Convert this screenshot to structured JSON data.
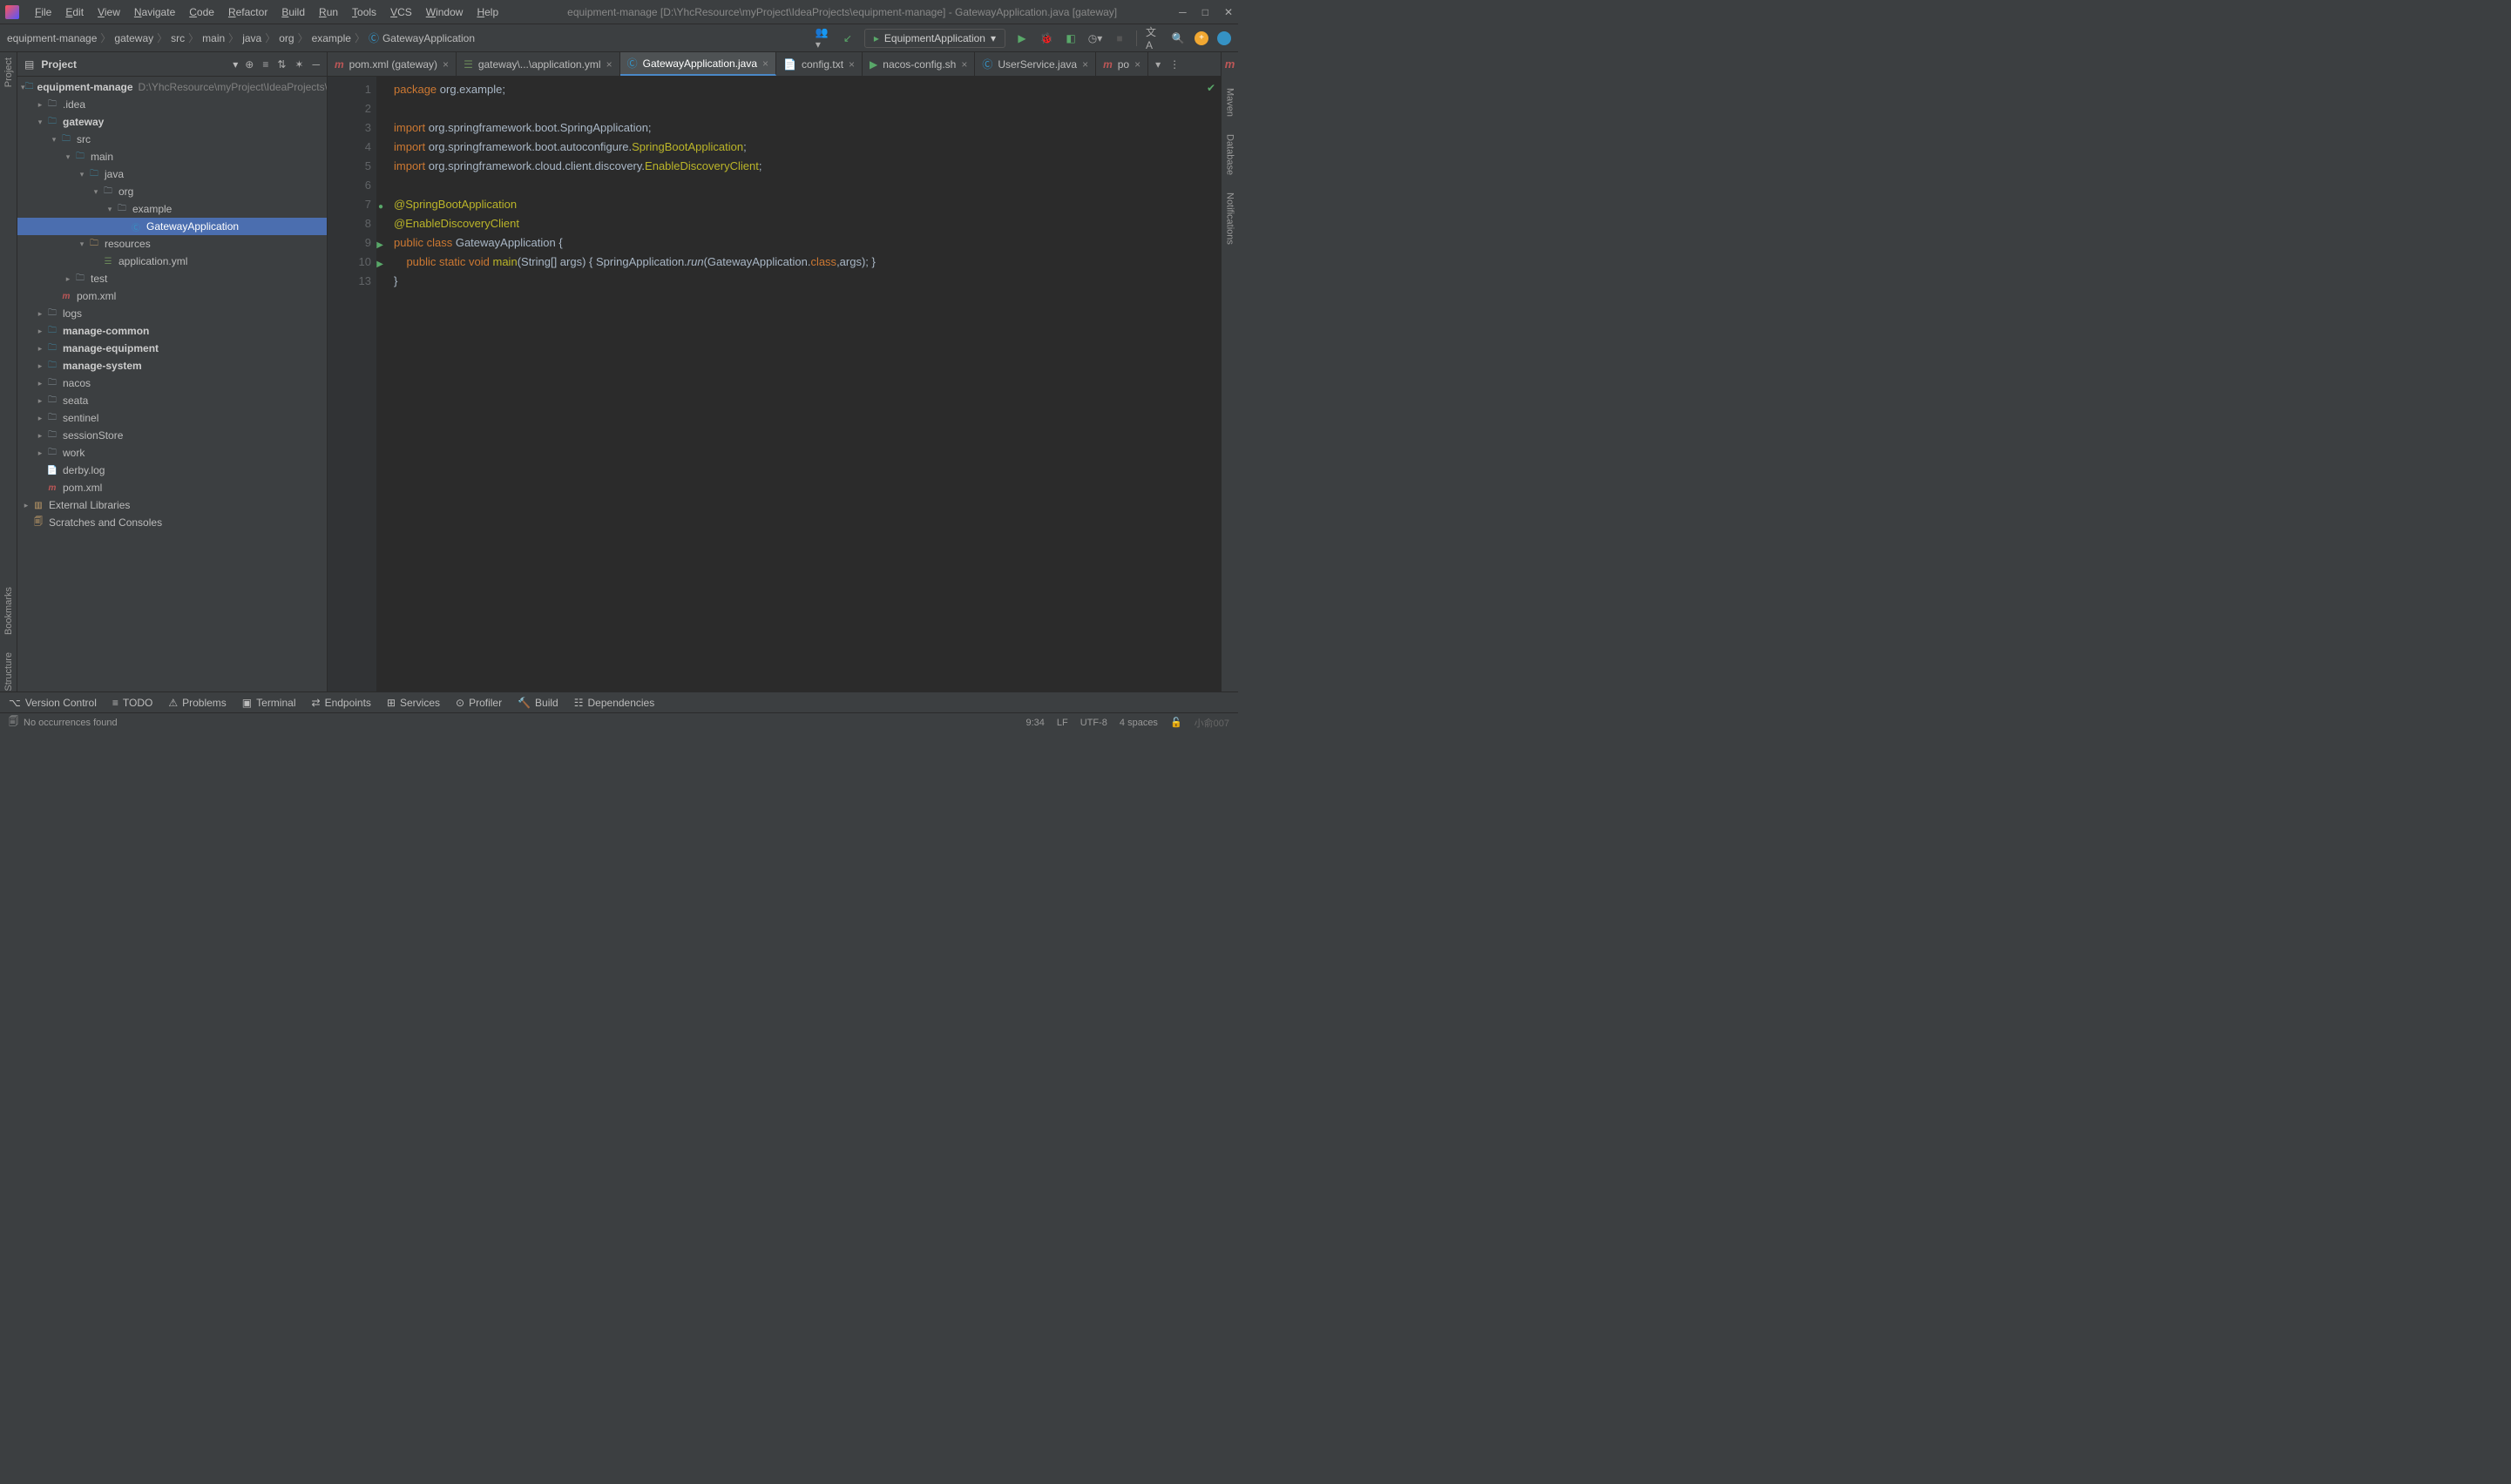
{
  "window": {
    "title": "equipment-manage [D:\\YhcResource\\myProject\\IdeaProjects\\equipment-manage] - GatewayApplication.java [gateway]"
  },
  "menu": [
    "File",
    "Edit",
    "View",
    "Navigate",
    "Code",
    "Refactor",
    "Build",
    "Run",
    "Tools",
    "VCS",
    "Window",
    "Help"
  ],
  "breadcrumb": [
    "equipment-manage",
    "gateway",
    "src",
    "main",
    "java",
    "org",
    "example",
    "GatewayApplication"
  ],
  "runConfig": "EquipmentApplication",
  "projectPanel": {
    "title": "Project"
  },
  "tree": {
    "root": "equipment-manage",
    "rootPath": "D:\\YhcResource\\myProject\\IdeaProjects\\equipment-manage",
    "items": [
      {
        "indent": 1,
        "arrow": ">",
        "icon": "folder",
        "label": ".idea"
      },
      {
        "indent": 1,
        "arrow": "v",
        "icon": "folder-src",
        "label": "gateway",
        "bold": true
      },
      {
        "indent": 2,
        "arrow": "v",
        "icon": "folder-src",
        "label": "src"
      },
      {
        "indent": 3,
        "arrow": "v",
        "icon": "folder-src",
        "label": "main"
      },
      {
        "indent": 4,
        "arrow": "v",
        "icon": "folder-src",
        "label": "java"
      },
      {
        "indent": 5,
        "arrow": "v",
        "icon": "folder",
        "label": "org"
      },
      {
        "indent": 6,
        "arrow": "v",
        "icon": "folder",
        "label": "example"
      },
      {
        "indent": 7,
        "arrow": "",
        "icon": "class",
        "label": "GatewayApplication",
        "selected": true
      },
      {
        "indent": 4,
        "arrow": "v",
        "icon": "folder-res",
        "label": "resources"
      },
      {
        "indent": 5,
        "arrow": "",
        "icon": "yml",
        "label": "application.yml"
      },
      {
        "indent": 3,
        "arrow": ">",
        "icon": "folder",
        "label": "test"
      },
      {
        "indent": 2,
        "arrow": "",
        "icon": "maven",
        "label": "pom.xml"
      },
      {
        "indent": 1,
        "arrow": ">",
        "icon": "folder",
        "label": "logs"
      },
      {
        "indent": 1,
        "arrow": ">",
        "icon": "folder-src",
        "label": "manage-common",
        "bold": true
      },
      {
        "indent": 1,
        "arrow": ">",
        "icon": "folder-src",
        "label": "manage-equipment",
        "bold": true
      },
      {
        "indent": 1,
        "arrow": ">",
        "icon": "folder-src",
        "label": "manage-system",
        "bold": true
      },
      {
        "indent": 1,
        "arrow": ">",
        "icon": "folder",
        "label": "nacos"
      },
      {
        "indent": 1,
        "arrow": ">",
        "icon": "folder",
        "label": "seata"
      },
      {
        "indent": 1,
        "arrow": ">",
        "icon": "folder",
        "label": "sentinel"
      },
      {
        "indent": 1,
        "arrow": ">",
        "icon": "folder",
        "label": "sessionStore"
      },
      {
        "indent": 1,
        "arrow": ">",
        "icon": "folder",
        "label": "work"
      },
      {
        "indent": 1,
        "arrow": "",
        "icon": "file",
        "label": "derby.log"
      },
      {
        "indent": 1,
        "arrow": "",
        "icon": "maven",
        "label": "pom.xml"
      }
    ],
    "external": "External Libraries",
    "scratches": "Scratches and Consoles"
  },
  "tabs": [
    {
      "icon": "maven",
      "label": "pom.xml (gateway)"
    },
    {
      "icon": "yml",
      "label": "gateway\\...\\application.yml"
    },
    {
      "icon": "class",
      "label": "GatewayApplication.java",
      "active": true
    },
    {
      "icon": "file",
      "label": "config.txt"
    },
    {
      "icon": "sh",
      "label": "nacos-config.sh"
    },
    {
      "icon": "class",
      "label": "UserService.java"
    },
    {
      "icon": "maven",
      "label": "po"
    }
  ],
  "code": {
    "lines": [
      {
        "n": 1,
        "html": "<span class='kw'>package</span> <span class='pkg'>org.example</span>;"
      },
      {
        "n": 2,
        "html": ""
      },
      {
        "n": 3,
        "html": "<span class='kw'>import</span> org.springframework.boot.SpringApplication;"
      },
      {
        "n": 4,
        "html": "<span class='kw'>import</span> org.springframework.boot.autoconfigure.<span class='ann'>SpringBootApplication</span>;"
      },
      {
        "n": 5,
        "html": "<span class='kw'>import</span> org.springframework.cloud.client.discovery.<span class='ann'>EnableDiscoveryClient</span>;"
      },
      {
        "n": 6,
        "html": ""
      },
      {
        "n": 7,
        "html": "<span class='ann'>@SpringBootApplication</span>",
        "mark": "●"
      },
      {
        "n": 8,
        "html": "<span class='ann'>@EnableDiscoveryClient</span>"
      },
      {
        "n": 9,
        "html": "<span class='kw'>public</span> <span class='kw'>class</span> <span class='cls'>GatewayApplication</span> {",
        "mark": "▶"
      },
      {
        "n": 10,
        "html": "    <span class='kw'>public</span> <span class='kw'>static</span> <span class='kw'>void</span> <span class='ann'>main</span>(String[] args) { SpringApplication.<span class='fn-it'>run</span>(GatewayApplication.<span class='kw'>class</span>,args); }",
        "mark": "▶"
      },
      {
        "n": 13,
        "html": "}"
      }
    ]
  },
  "bottomTools": [
    "Version Control",
    "TODO",
    "Problems",
    "Terminal",
    "Endpoints",
    "Services",
    "Profiler",
    "Build",
    "Dependencies"
  ],
  "status": {
    "left": "No occurrences found",
    "pos": "9:34",
    "sep": "LF",
    "enc": "UTF-8",
    "indent": "4 spaces"
  },
  "leftRail": [
    "Project",
    "Bookmarks",
    "Structure"
  ],
  "rightRail": [
    "Maven",
    "Database",
    "Notifications"
  ]
}
